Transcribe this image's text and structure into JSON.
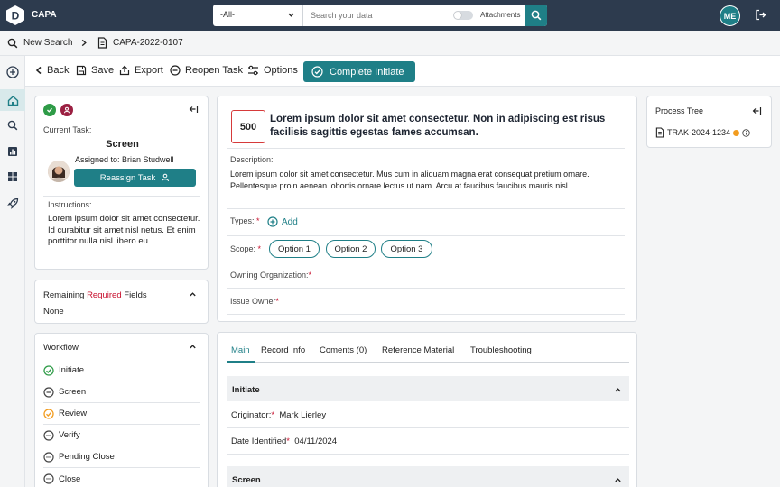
{
  "app": {
    "title": "CAPA",
    "logo_letter": "D"
  },
  "search": {
    "scope": "-All-",
    "placeholder": "Search your data",
    "attachments_label": "Attachments"
  },
  "user": {
    "initials": "ME"
  },
  "breadcrumb": {
    "new_search": "New Search",
    "record_id": "CAPA-2022-0107"
  },
  "toolbar": {
    "back": "Back",
    "save": "Save",
    "export": "Export",
    "reopen": "Reopen Task",
    "options": "Options",
    "complete": "Complete Initiate"
  },
  "task": {
    "current_task_label": "Current Task:",
    "task_name": "Screen",
    "assigned_to": "Assigned to: Brian Studwell",
    "reassign_label": "Reassign Task",
    "instructions_label": "Instructions:",
    "instructions": "Lorem ipsum dolor sit amet consectetur. Id curabitur sit amet nisl netus. Et enim porttitor nulla nisl libero eu."
  },
  "remaining": {
    "prefix": "Remaining ",
    "required": "Required",
    "suffix": " Fields",
    "value": "None"
  },
  "workflow": {
    "title": "Workflow",
    "steps": [
      {
        "label": "Initiate",
        "status": "complete"
      },
      {
        "label": "Screen",
        "status": "current"
      },
      {
        "label": "Review",
        "status": "warning"
      },
      {
        "label": "Verify",
        "status": "pending"
      },
      {
        "label": "Pending Close",
        "status": "pending"
      },
      {
        "label": "Close",
        "status": "pending"
      }
    ]
  },
  "issue": {
    "priority": "500",
    "title": "Lorem ipsum dolor sit amet consectetur. Non in adipiscing est risus facilisis sagittis egestas fames accumsan.",
    "description_label": "Description:",
    "description": "Lorem ipsum dolor sit amet consectetur. Mus cum in aliquam magna erat consequat pretium ornare. Pellentesque proin aenean lobortis ornare lectus ut nam. Arcu at faucibus faucibus mauris nisl.",
    "types_label": "Types:",
    "add_label": "Add",
    "scope_label": "Scope:",
    "options": [
      "Option 1",
      "Option 2",
      "Option 3"
    ],
    "owning_org_label": "Owning Organization:",
    "issue_owner_label": "Issue Owner"
  },
  "tabs": [
    "Main",
    "Record Info",
    "Coments (0)",
    "Reference Material",
    "Troubleshooting"
  ],
  "sections": {
    "initiate": "Initiate",
    "originator_label": "Originator:",
    "originator_value": "Mark Lierley",
    "date_label": "Date Identified",
    "date_value": "04/11/2024",
    "screen": "Screen"
  },
  "process_tree": {
    "title": "Process Tree",
    "item": "TRAK-2024-1234"
  },
  "colors": {
    "brand": "#1f7f87",
    "topbar": "#2d3b4e",
    "required": "#c8102e",
    "warning": "#f29c1f",
    "complete": "#2e9b47"
  }
}
